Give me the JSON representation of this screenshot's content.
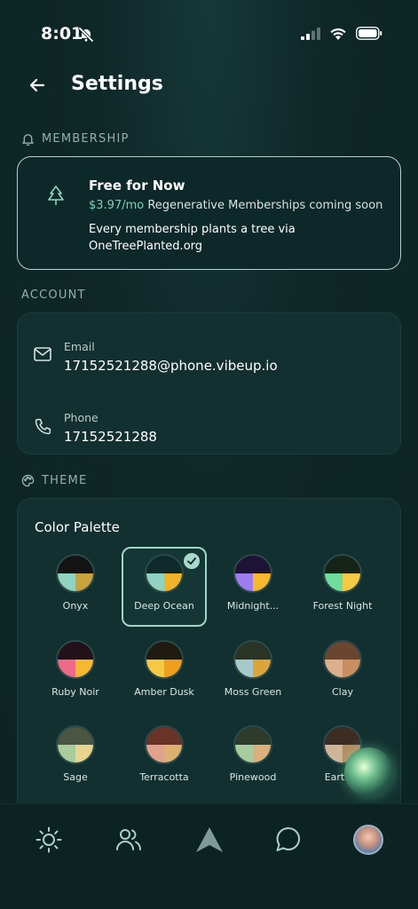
{
  "status": {
    "time": "8:01"
  },
  "header": {
    "title": "Settings"
  },
  "membership": {
    "section_label": "MEMBERSHIP",
    "title": "Free for Now",
    "price": "$3.97/mo",
    "price_suffix": " Regenerative Memberships coming soon",
    "description": "Every membership plants a tree via OneTreePlanted.org"
  },
  "account": {
    "section_label": "ACCOUNT",
    "email_label": "Email",
    "email_value": "17152521288@phone.vibeup.io",
    "phone_label": "Phone",
    "phone_value": "17152521288"
  },
  "theme": {
    "section_label": "THEME",
    "palette_title": "Color Palette",
    "palettes": [
      {
        "name": "Onyx",
        "top": "#141414",
        "bl": "#8fd3c0",
        "br": "#c9a43e"
      },
      {
        "name": "Deep Ocean",
        "top": "#0f2a2a",
        "bl": "#8fd3c0",
        "br": "#f0b429",
        "selected": true
      },
      {
        "name": "Midnight...",
        "top": "#1e1236",
        "bl": "#9d7df0",
        "br": "#f5b82e"
      },
      {
        "name": "Forest Night",
        "top": "#162418",
        "bl": "#6fdc9c",
        "br": "#f6c945"
      },
      {
        "name": "Ruby Noir",
        "top": "#23111a",
        "bl": "#ee6a88",
        "br": "#f5b82e"
      },
      {
        "name": "Amber Dusk",
        "top": "#1f1a12",
        "bl": "#f6c945",
        "br": "#ee9f1e"
      },
      {
        "name": "Moss Green",
        "top": "#2a3326",
        "bl": "#a6c9cc",
        "br": "#dca53a"
      },
      {
        "name": "Clay",
        "top": "#6a4530",
        "bl": "#dcb08c",
        "br": "#c89062"
      },
      {
        "name": "Sage",
        "top": "#4a5542",
        "bl": "#a8cc9c",
        "br": "#e8d48f"
      },
      {
        "name": "Terracotta",
        "top": "#6a3328",
        "bl": "#e0a28a",
        "br": "#dcb070"
      },
      {
        "name": "Pinewood",
        "top": "#2e3b2a",
        "bl": "#a9cc9e",
        "br": "#dcb07c"
      },
      {
        "name": "Earth B",
        "top": "#3c2c22",
        "bl": "#d0b49a",
        "br": "#b88a60"
      }
    ]
  },
  "nav": {
    "items": [
      "sun-icon",
      "people-icon",
      "compass-arrow-icon",
      "chat-icon",
      "profile-avatar"
    ]
  }
}
